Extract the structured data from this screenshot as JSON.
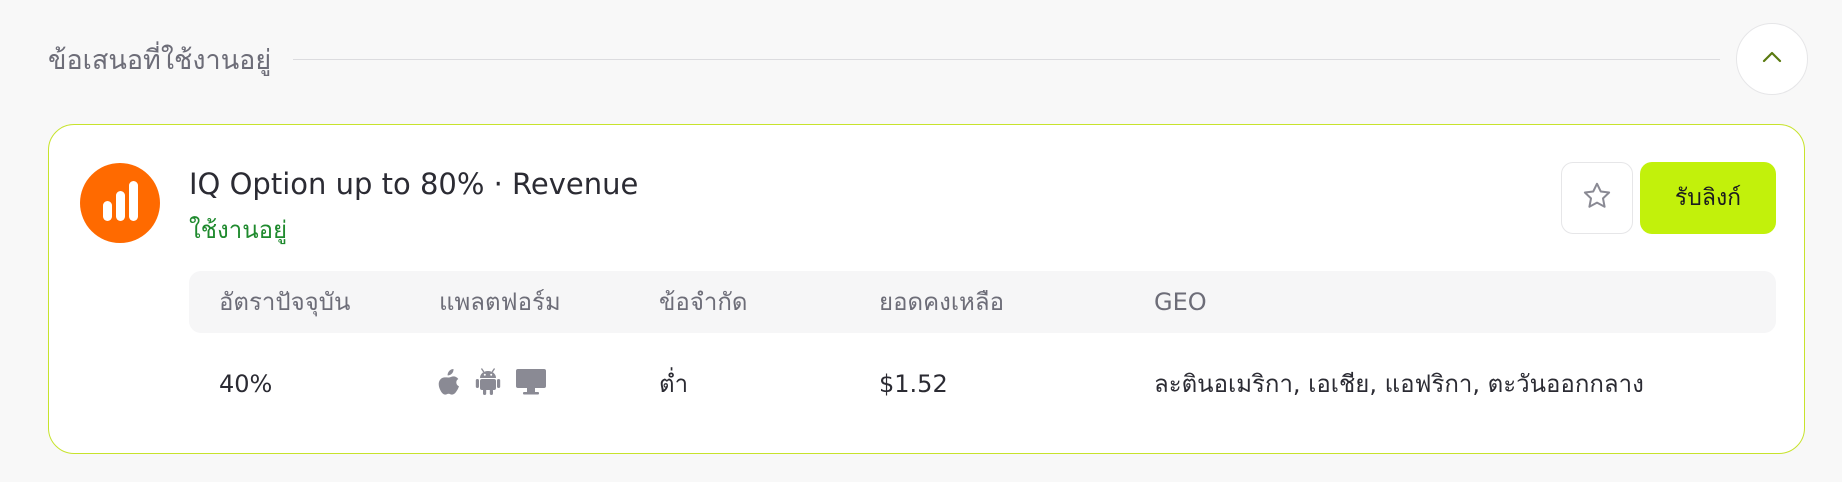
{
  "section": {
    "title": "ข้อเสนอที่ใช้งานอยู่",
    "collapse_icon": "chevron-up-icon"
  },
  "offer": {
    "logo_icon": "iq-option-bars-logo",
    "title": "IQ Option up to 80% · Revenue",
    "status": "ใช้งานอยู่",
    "favorite_icon": "star-outline-icon",
    "get_link_label": "รับลิงก์",
    "columns": [
      "อัตราปัจจุบัน",
      "แพลตฟอร์ม",
      "ข้อจำกัด",
      "ยอดคงเหลือ",
      "GEO"
    ],
    "row": {
      "rate": "40%",
      "platforms": [
        "apple-icon",
        "android-icon",
        "desktop-icon"
      ],
      "limit": "ต่ำ",
      "balance": "$1.52",
      "geo": "ละตินอเมริกา, เอเชีย, แอฟริกา, ตะวันออกกลาง"
    }
  },
  "colors": {
    "accent_border": "#c7e32c",
    "button_bg": "#c2f10b",
    "status_green": "#1f8a2e",
    "logo_orange": "#ff6a00",
    "icon_gray": "#8a8a94"
  }
}
